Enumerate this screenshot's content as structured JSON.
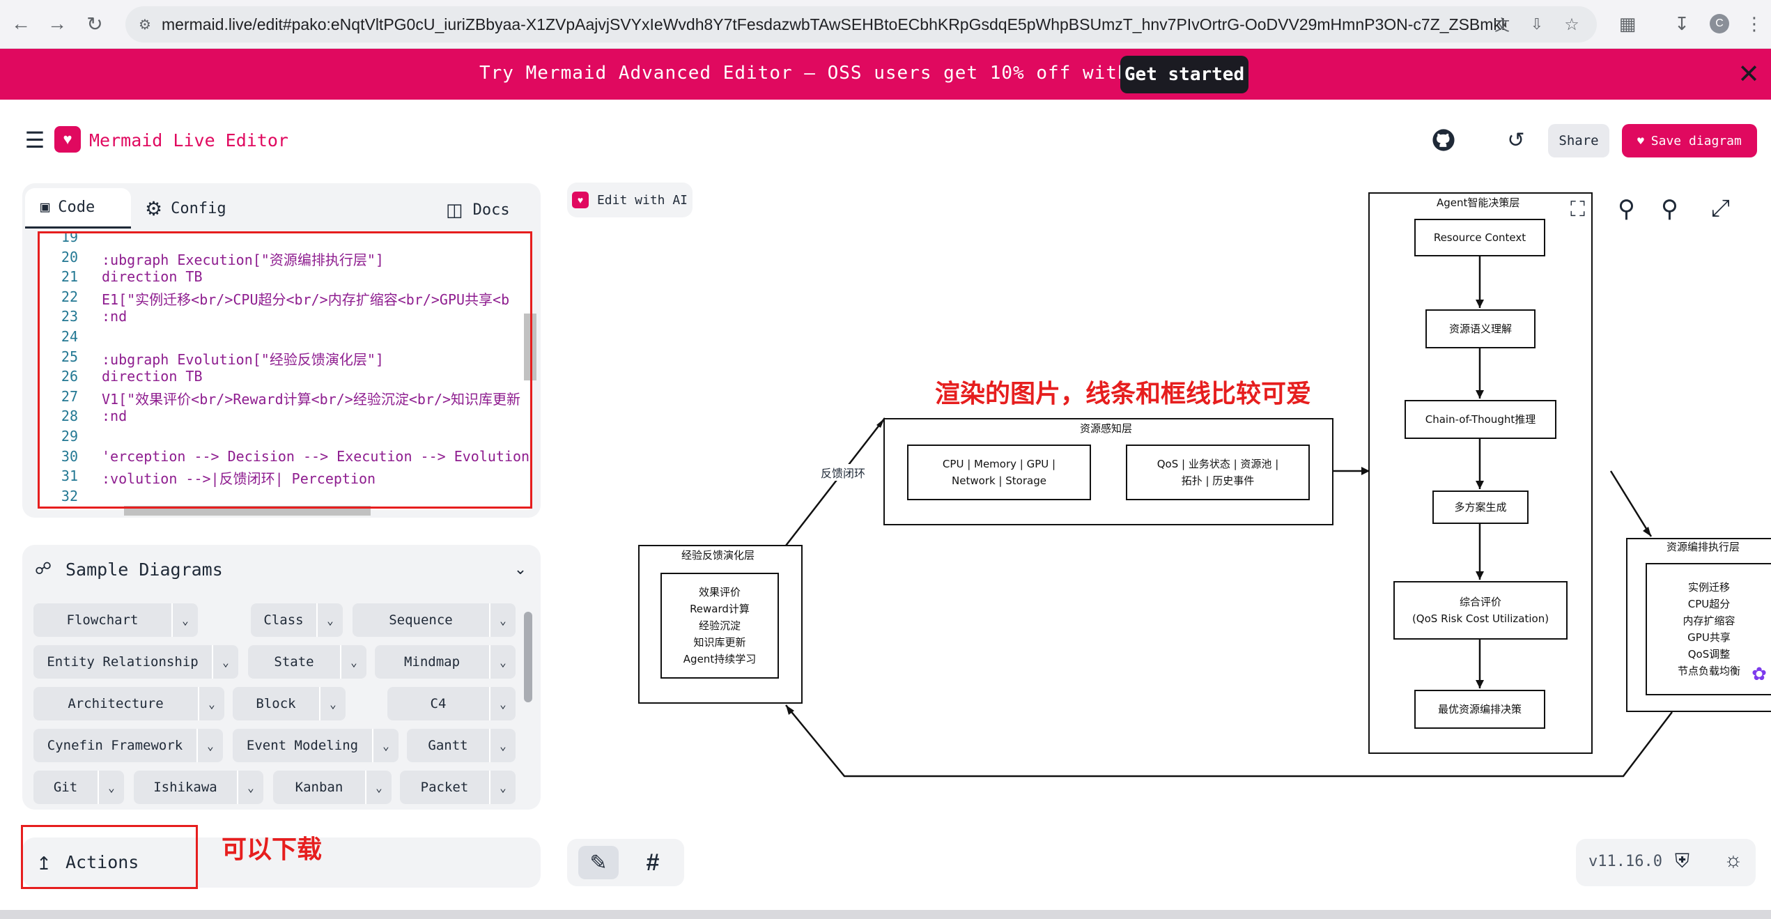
{
  "browser": {
    "url": "mermaid.live/edit#pako:eNqtVltPG0cU_iuriZBbyaa-X1ZVpAajvjSVYxIeWvdh8Y7tFesdazwbTAwSEHBtoECbhKRpGsdqE5pWhpBSUmzT_hnv7PIvOrtrG-OoDVV29mHmnP3ON-c7Z_ZSBmkkQs...",
    "icons": [
      "back-icon",
      "forward-icon",
      "reload-icon",
      "site-settings-icon",
      "translate-icon",
      "install-icon",
      "bookmark-star-icon",
      "extensions-icon",
      "download-icon",
      "profile-icon",
      "menu-dots-icon"
    ],
    "profile_initial": "C"
  },
  "banner": {
    "text": "Try Mermaid Advanced Editor — OSS users get 10% off with code JS26",
    "cta": "Get started",
    "bg": "#e0095f"
  },
  "header": {
    "title": "Mermaid Live Editor",
    "share": "Share",
    "save": "Save diagram",
    "accent": "#e0095f"
  },
  "editor": {
    "tabs": {
      "code": "Code",
      "config": "Config",
      "docs": "Docs"
    },
    "lines": [
      {
        "n": "19",
        "t": ""
      },
      {
        "n": "20",
        "t": ":ubgraph Execution[\"资源编排执行层\"]"
      },
      {
        "n": "21",
        "t": "    direction TB"
      },
      {
        "n": "22",
        "t": "    E1[\"实例迁移<br/>CPU超分<br/>内存扩缩容<br/>GPU共享<b"
      },
      {
        "n": "23",
        "t": ":nd"
      },
      {
        "n": "24",
        "t": ""
      },
      {
        "n": "25",
        "t": ":ubgraph Evolution[\"经验反馈演化层\"]"
      },
      {
        "n": "26",
        "t": "    direction TB"
      },
      {
        "n": "27",
        "t": "    V1[\"效果评价<br/>Reward计算<br/>经验沉淀<br/>知识库更新"
      },
      {
        "n": "28",
        "t": ":nd"
      },
      {
        "n": "29",
        "t": ""
      },
      {
        "n": "30",
        "t": "'erception --> Decision --> Execution --> Evolution"
      },
      {
        "n": "31",
        "t": ":volution -->|反馈闭环| Perception"
      },
      {
        "n": "32",
        "t": ""
      }
    ]
  },
  "samples": {
    "title": "Sample Diagrams",
    "items": [
      "Flowchart",
      "Class",
      "Sequence",
      "Entity Relationship",
      "State",
      "Mindmap",
      "Architecture",
      "Block",
      "C4",
      "Cynefin Framework",
      "Event Modeling",
      "Gantt",
      "Git",
      "Ishikawa",
      "Kanban",
      "Packet"
    ]
  },
  "actions": {
    "label": "Actions"
  },
  "toolbar": {
    "edit_ai": "Edit with AI",
    "version": "v11.16.0"
  },
  "annotations": {
    "render_note": "渲染的图片，线条和框线比较可爱",
    "download_note": "可以下载"
  },
  "diagram": {
    "perception": {
      "title": "资源感知层",
      "node1_l1": "CPU | Memory | GPU |",
      "node1_l2": "Network | Storage",
      "node2_l1": "QoS | 业务状态 | 资源池 |",
      "node2_l2": "拓扑 | 历史事件"
    },
    "decision": {
      "title": "Agent智能决策层",
      "n1": "Resource Context",
      "n2": "资源语义理解",
      "n3": "Chain-of-Thought推理",
      "n4": "多方案生成",
      "n5_l1": "综合评价",
      "n5_l2": "(QoS Risk Cost Utilization)",
      "n6": "最优资源编排决策"
    },
    "execution": {
      "title": "资源编排执行层",
      "items": [
        "实例迁移",
        "CPU超分",
        "内存扩缩容",
        "GPU共享",
        "QoS调整",
        "节点负载均衡"
      ]
    },
    "evolution": {
      "title": "经验反馈演化层",
      "items": [
        "效果评价",
        "Reward计算",
        "经验沉淀",
        "知识库更新",
        "Agent持续学习"
      ]
    },
    "loop_label": "反馈闭环"
  }
}
